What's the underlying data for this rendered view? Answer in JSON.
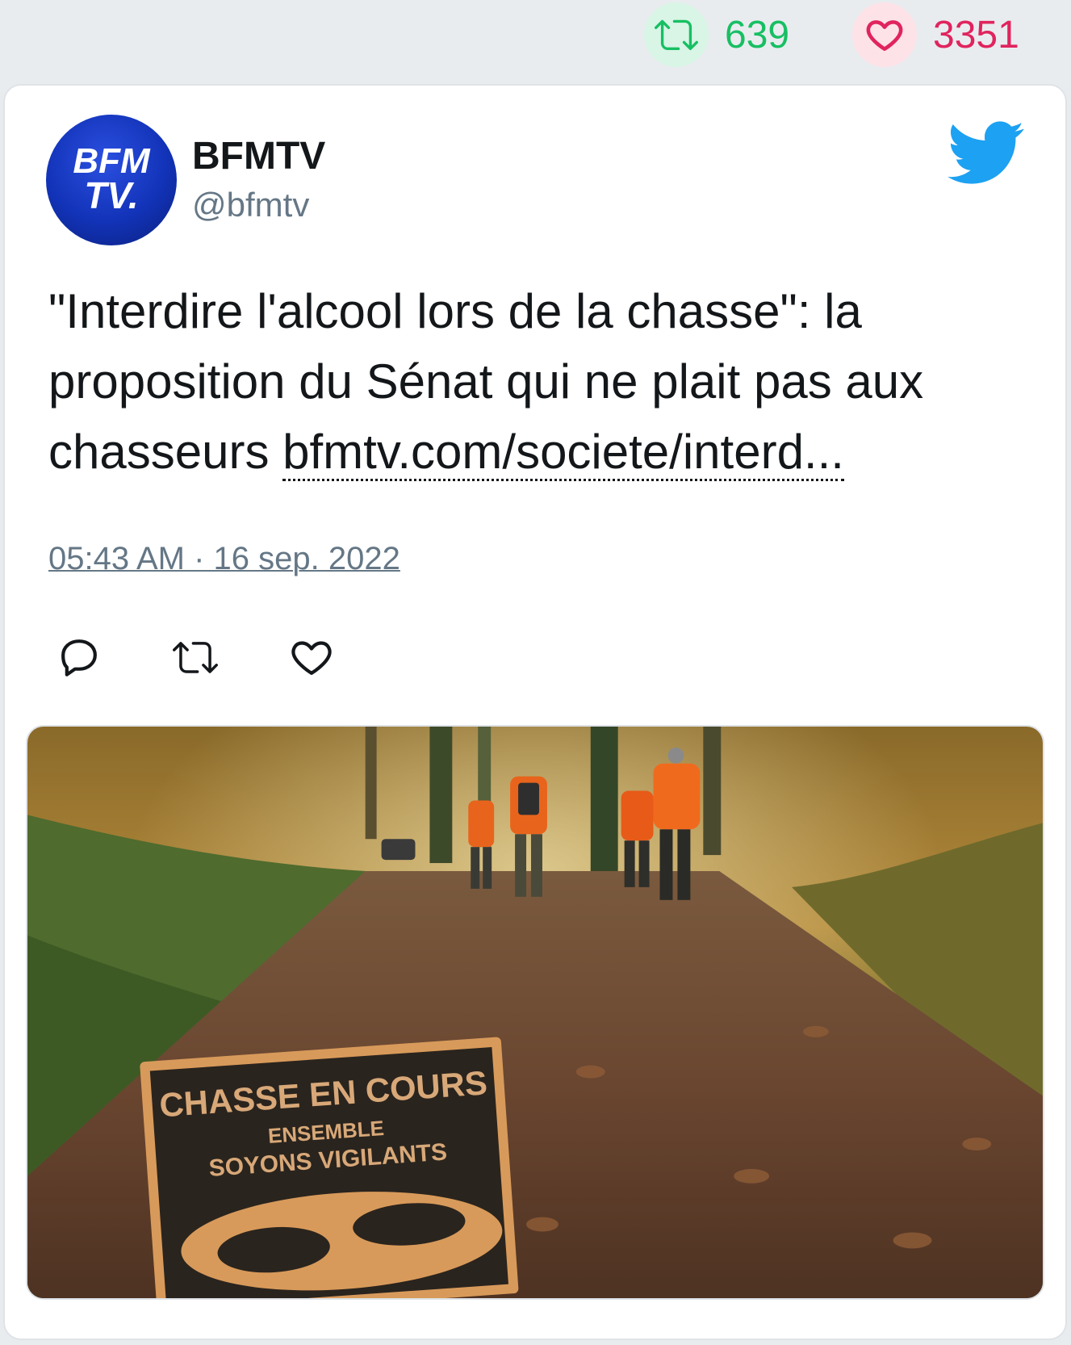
{
  "stats": {
    "retweet_count": "639",
    "like_count": "3351",
    "retweet_icon": "retweet-icon",
    "like_icon": "heart-icon",
    "retweet_color": "#17bf63",
    "like_color": "#e0245e"
  },
  "tweet": {
    "author": {
      "name": "BFMTV",
      "handle": "@bfmtv",
      "avatar_text_top": "BFM",
      "avatar_text_bottom": "TV."
    },
    "text": "\"Interdire l'alcool lors de la chasse\": la proposition du Sénat qui ne plait pas aux chasseurs ",
    "link_text": "bfmtv.com/societe/interd...",
    "timestamp": "05:43 AM · 16 sep. 2022",
    "actions": [
      "reply-icon",
      "retweet-icon",
      "heart-icon"
    ],
    "media": {
      "sign_line1": "CHASSE EN COURS",
      "sign_line2": "ENSEMBLE",
      "sign_line3": "SOYONS VIGILANTS"
    },
    "brand_color": "#1da1f2"
  }
}
